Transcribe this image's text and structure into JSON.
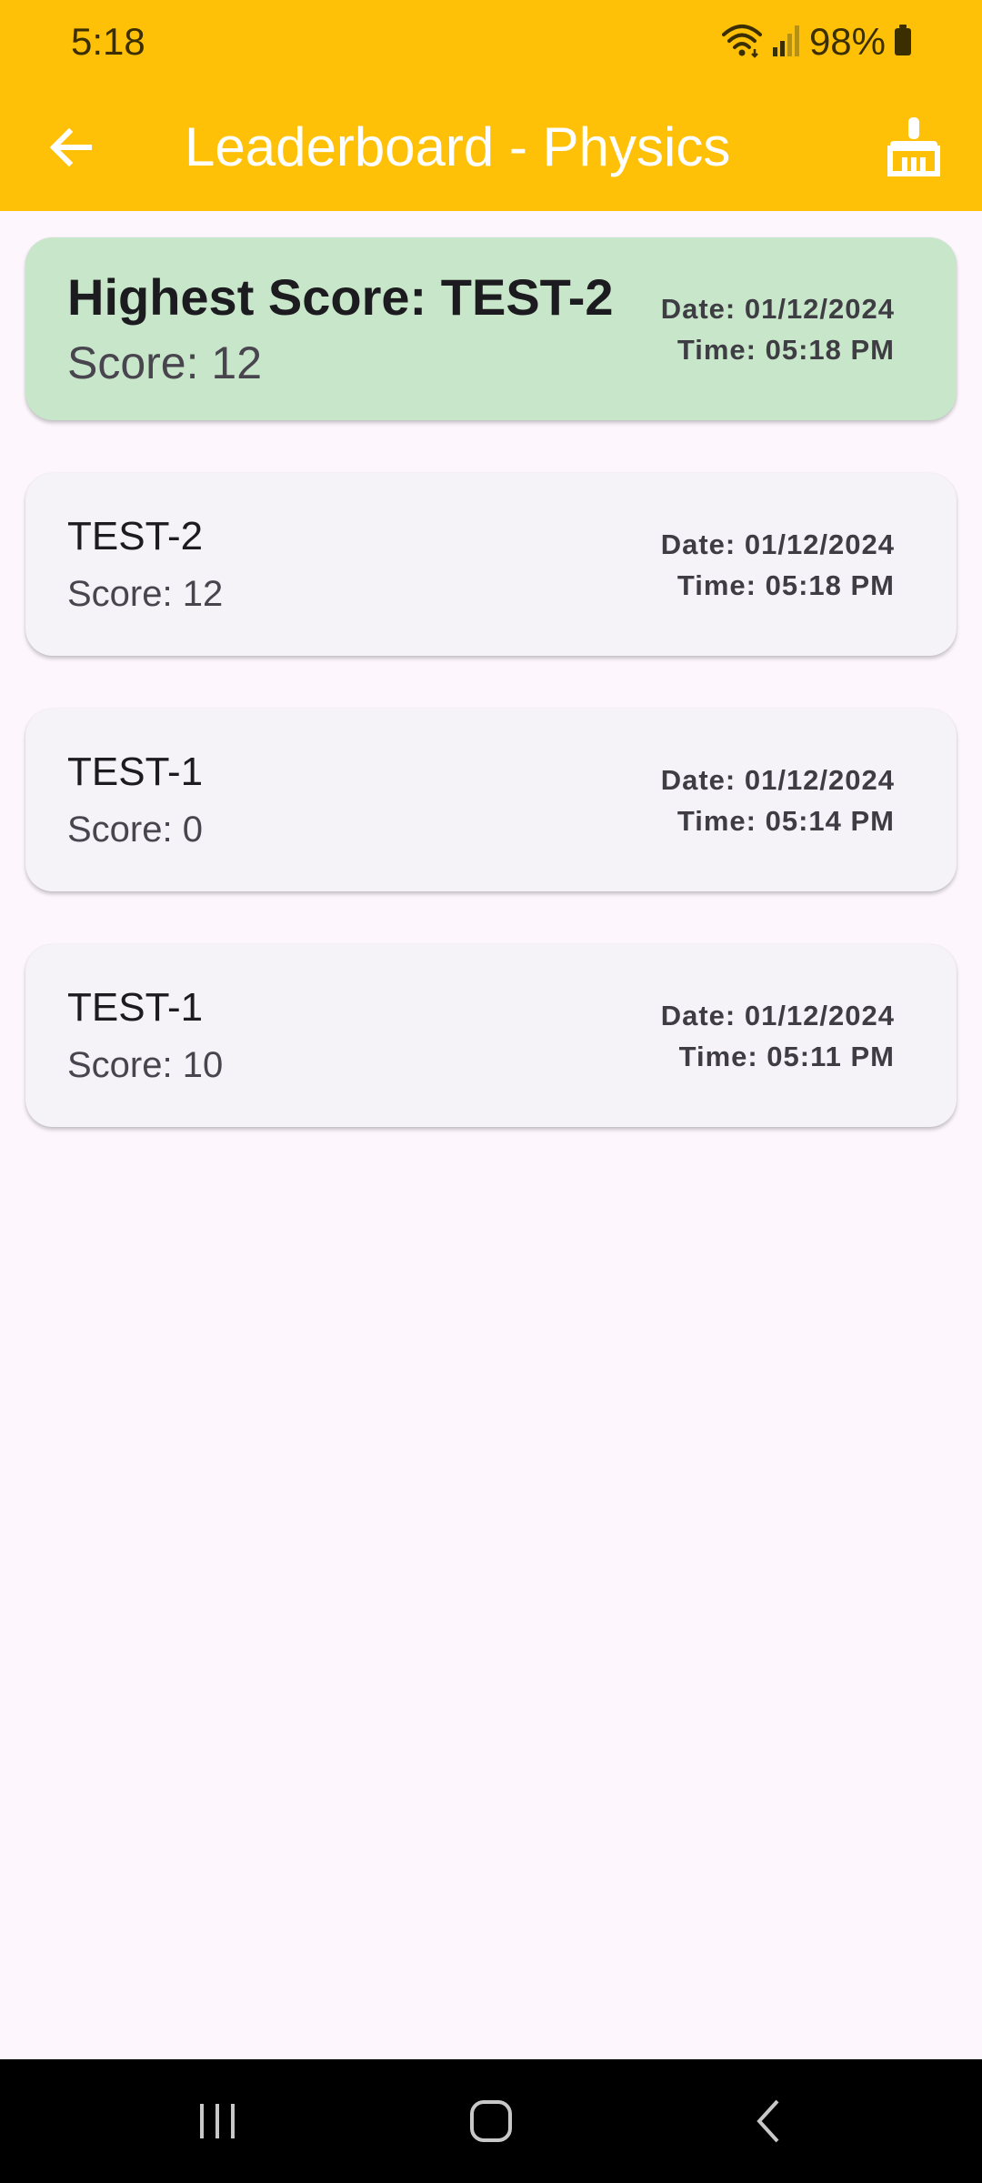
{
  "status_bar": {
    "time": "5:18",
    "battery": "98%",
    "icons": [
      "wifi-icon",
      "signal-icon",
      "battery-icon"
    ]
  },
  "app_bar": {
    "title": "Leaderboard - Physics",
    "back_icon": "arrow-back-icon",
    "action_icon": "cleaning-brush-icon",
    "color": "#ffc107"
  },
  "highest": {
    "name": "Highest Score: TEST-2",
    "score": "Score: 12",
    "date": "Date: 01/12/2024",
    "time": "Time: 05:18 PM",
    "color": "#c8e6c9"
  },
  "entries": [
    {
      "name": "TEST-2",
      "score": "Score: 12",
      "date": "Date: 01/12/2024",
      "time": "Time: 05:18 PM"
    },
    {
      "name": "TEST-1",
      "score": "Score: 0",
      "date": "Date: 01/12/2024",
      "time": "Time: 05:14 PM"
    },
    {
      "name": "TEST-1",
      "score": "Score: 10",
      "date": "Date: 01/12/2024",
      "time": "Time: 05:11 PM"
    }
  ],
  "nav_bar": {
    "icons": [
      "recent-apps-icon",
      "home-icon",
      "back-icon"
    ]
  }
}
